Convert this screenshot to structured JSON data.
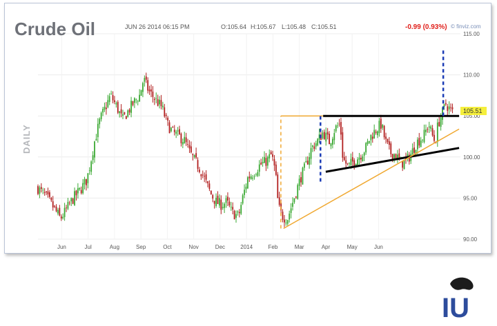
{
  "chart_data": {
    "type": "candlestick",
    "title": "Crude Oil",
    "timeframe_label": "DAILY",
    "header": {
      "datetime": "JUN 26 2014 06:15 PM",
      "open": "O:105.64",
      "high": "H:105.67",
      "low": "L:105.48",
      "close": "C:105.51",
      "change": "-0.99 (0.93%)",
      "source": "© finviz.com"
    },
    "last_price_label": "105.51",
    "ylim": [
      90,
      115
    ],
    "yticks": [
      {
        "value": 115,
        "label": "115.00"
      },
      {
        "value": 110,
        "label": "110.00"
      },
      {
        "value": 105,
        "label": "105.00"
      },
      {
        "value": 100,
        "label": "100.00"
      },
      {
        "value": 95,
        "label": "95.00"
      },
      {
        "value": 90,
        "label": "90.00"
      }
    ],
    "xticks": [
      "Jun",
      "Jul",
      "Aug",
      "Sep",
      "Oct",
      "Nov",
      "Dec",
      "2014",
      "Feb",
      "Mar",
      "Apr",
      "May",
      "Jun"
    ],
    "x_domain": [
      0,
      13
    ],
    "xtick_positions": [
      0.9,
      1.9,
      2.9,
      3.9,
      4.9,
      5.9,
      6.9,
      7.9,
      8.9,
      9.9,
      10.9,
      11.9,
      12.9
    ],
    "close_path": [
      [
        0.0,
        96.2
      ],
      [
        0.35,
        95.0
      ],
      [
        0.6,
        93.8
      ],
      [
        0.85,
        92.5
      ],
      [
        1.0,
        93.2
      ],
      [
        1.3,
        94.8
      ],
      [
        1.6,
        96.0
      ],
      [
        1.85,
        97.2
      ],
      [
        2.0,
        99.5
      ],
      [
        2.15,
        102.0
      ],
      [
        2.35,
        104.5
      ],
      [
        2.55,
        106.0
      ],
      [
        2.75,
        107.5
      ],
      [
        3.0,
        106.0
      ],
      [
        3.2,
        104.5
      ],
      [
        3.4,
        105.5
      ],
      [
        3.6,
        106.5
      ],
      [
        3.85,
        107.5
      ],
      [
        4.0,
        109.5
      ],
      [
        4.2,
        108.0
      ],
      [
        4.45,
        107.0
      ],
      [
        4.7,
        106.0
      ],
      [
        4.9,
        104.0
      ],
      [
        5.1,
        103.0
      ],
      [
        5.35,
        102.5
      ],
      [
        5.55,
        102.0
      ],
      [
        5.75,
        100.5
      ],
      [
        5.95,
        99.5
      ],
      [
        6.15,
        98.5
      ],
      [
        6.35,
        97.0
      ],
      [
        6.55,
        95.5
      ],
      [
        6.75,
        94.5
      ],
      [
        6.95,
        94.2
      ],
      [
        7.15,
        94.5
      ],
      [
        7.35,
        93.2
      ],
      [
        7.6,
        92.8
      ],
      [
        7.75,
        95.0
      ],
      [
        7.95,
        97.5
      ],
      [
        8.15,
        98.0
      ],
      [
        8.4,
        99.0
      ],
      [
        8.65,
        99.5
      ],
      [
        8.85,
        100.3
      ],
      [
        9.0,
        98.0
      ],
      [
        9.1,
        94.0
      ],
      [
        9.25,
        92.8
      ],
      [
        9.45,
        92.5
      ],
      [
        9.7,
        95.0
      ],
      [
        9.95,
        97.5
      ],
      [
        10.15,
        99.0
      ],
      [
        10.35,
        101.0
      ],
      [
        10.6,
        102.0
      ],
      [
        10.8,
        103.0
      ],
      [
        11.05,
        101.8
      ],
      [
        11.25,
        103.5
      ],
      [
        11.45,
        104.0
      ],
      [
        11.55,
        99.8
      ],
      [
        11.75,
        98.8
      ],
      [
        11.95,
        99.5
      ],
      [
        12.15,
        100.0
      ],
      [
        12.4,
        101.0
      ],
      [
        12.6,
        102.5
      ],
      [
        12.85,
        103.5
      ],
      [
        13.0,
        104.0
      ],
      [
        13.15,
        102.0
      ],
      [
        13.35,
        100.5
      ],
      [
        13.55,
        100.3
      ],
      [
        13.75,
        99.2
      ],
      [
        13.95,
        99.5
      ],
      [
        14.15,
        100.5
      ],
      [
        14.35,
        101.8
      ],
      [
        14.6,
        102.5
      ],
      [
        14.8,
        104.0
      ],
      [
        14.95,
        102.5
      ],
      [
        15.05,
        101.8
      ],
      [
        15.15,
        104.0
      ],
      [
        15.3,
        105.2
      ],
      [
        15.45,
        106.5
      ],
      [
        15.55,
        106.0
      ],
      [
        15.7,
        105.5
      ]
    ],
    "annotations": [
      {
        "kind": "hline",
        "color": "#000000",
        "width": 3,
        "points": [
          [
            10.8,
            105.0
          ],
          [
            15.95,
            105.0
          ]
        ]
      },
      {
        "kind": "line",
        "color": "#000000",
        "width": 3,
        "points": [
          [
            10.9,
            98.2
          ],
          [
            15.95,
            101.1
          ]
        ]
      },
      {
        "kind": "line",
        "color": "#f0a830",
        "width": 1.5,
        "points": [
          [
            9.3,
            91.3
          ],
          [
            15.95,
            103.4
          ]
        ]
      },
      {
        "kind": "hline",
        "color": "#f0a830",
        "width": 1.5,
        "points": [
          [
            9.2,
            105.0
          ],
          [
            10.8,
            105.0
          ]
        ]
      },
      {
        "kind": "vline-dashed",
        "color": "#f0a830",
        "width": 1.5,
        "points": [
          [
            9.2,
            91.3
          ],
          [
            9.2,
            105.0
          ]
        ]
      },
      {
        "kind": "vline-dashed",
        "color": "#1a3bb5",
        "width": 2.5,
        "points": [
          [
            10.7,
            97.0
          ],
          [
            10.7,
            105.0
          ]
        ]
      },
      {
        "kind": "vline-dashed",
        "color": "#1a3bb5",
        "width": 2.5,
        "points": [
          [
            15.35,
            105.0
          ],
          [
            15.35,
            113.0
          ]
        ]
      }
    ],
    "grid": true,
    "colors": {
      "up": "#3aa832",
      "down": "#b11e1e",
      "change": "#e0201b",
      "label_bg": "#f5ef3c"
    }
  },
  "logo": {
    "text": "IU"
  }
}
